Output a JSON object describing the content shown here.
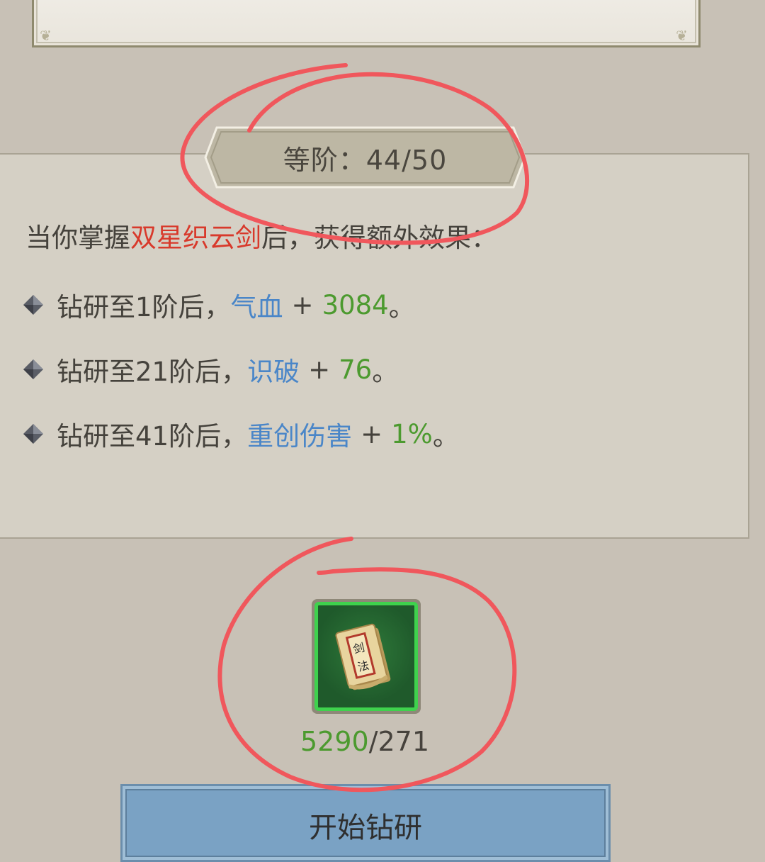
{
  "grade": {
    "label": "等阶：44/50"
  },
  "effects": {
    "intro_prefix": "当你掌握",
    "skill_name": "双星织云剑",
    "intro_suffix": "后，获得额外效果：",
    "items": [
      {
        "prefix": "钻研至1阶后，",
        "stat": "气血",
        "plus": "+",
        "value": "3084",
        "end": "。"
      },
      {
        "prefix": "钻研至21阶后，",
        "stat": "识破",
        "plus": "+",
        "value": "76",
        "end": "。"
      },
      {
        "prefix": "钻研至41阶后，",
        "stat": "重创伤害",
        "plus": "+",
        "value": "1%",
        "end": "。"
      }
    ]
  },
  "material": {
    "icon": "sword-manual-scroll-icon",
    "have": "5290",
    "need": "/271",
    "item_glyphs": "剑法"
  },
  "actions": {
    "start_label": "开始钻研"
  },
  "colors": {
    "skill_name": "#d8392b",
    "stat": "#4a86c8",
    "value": "#4c9a2f",
    "annotation": "#f0575c",
    "button": "#7aa2c4"
  }
}
